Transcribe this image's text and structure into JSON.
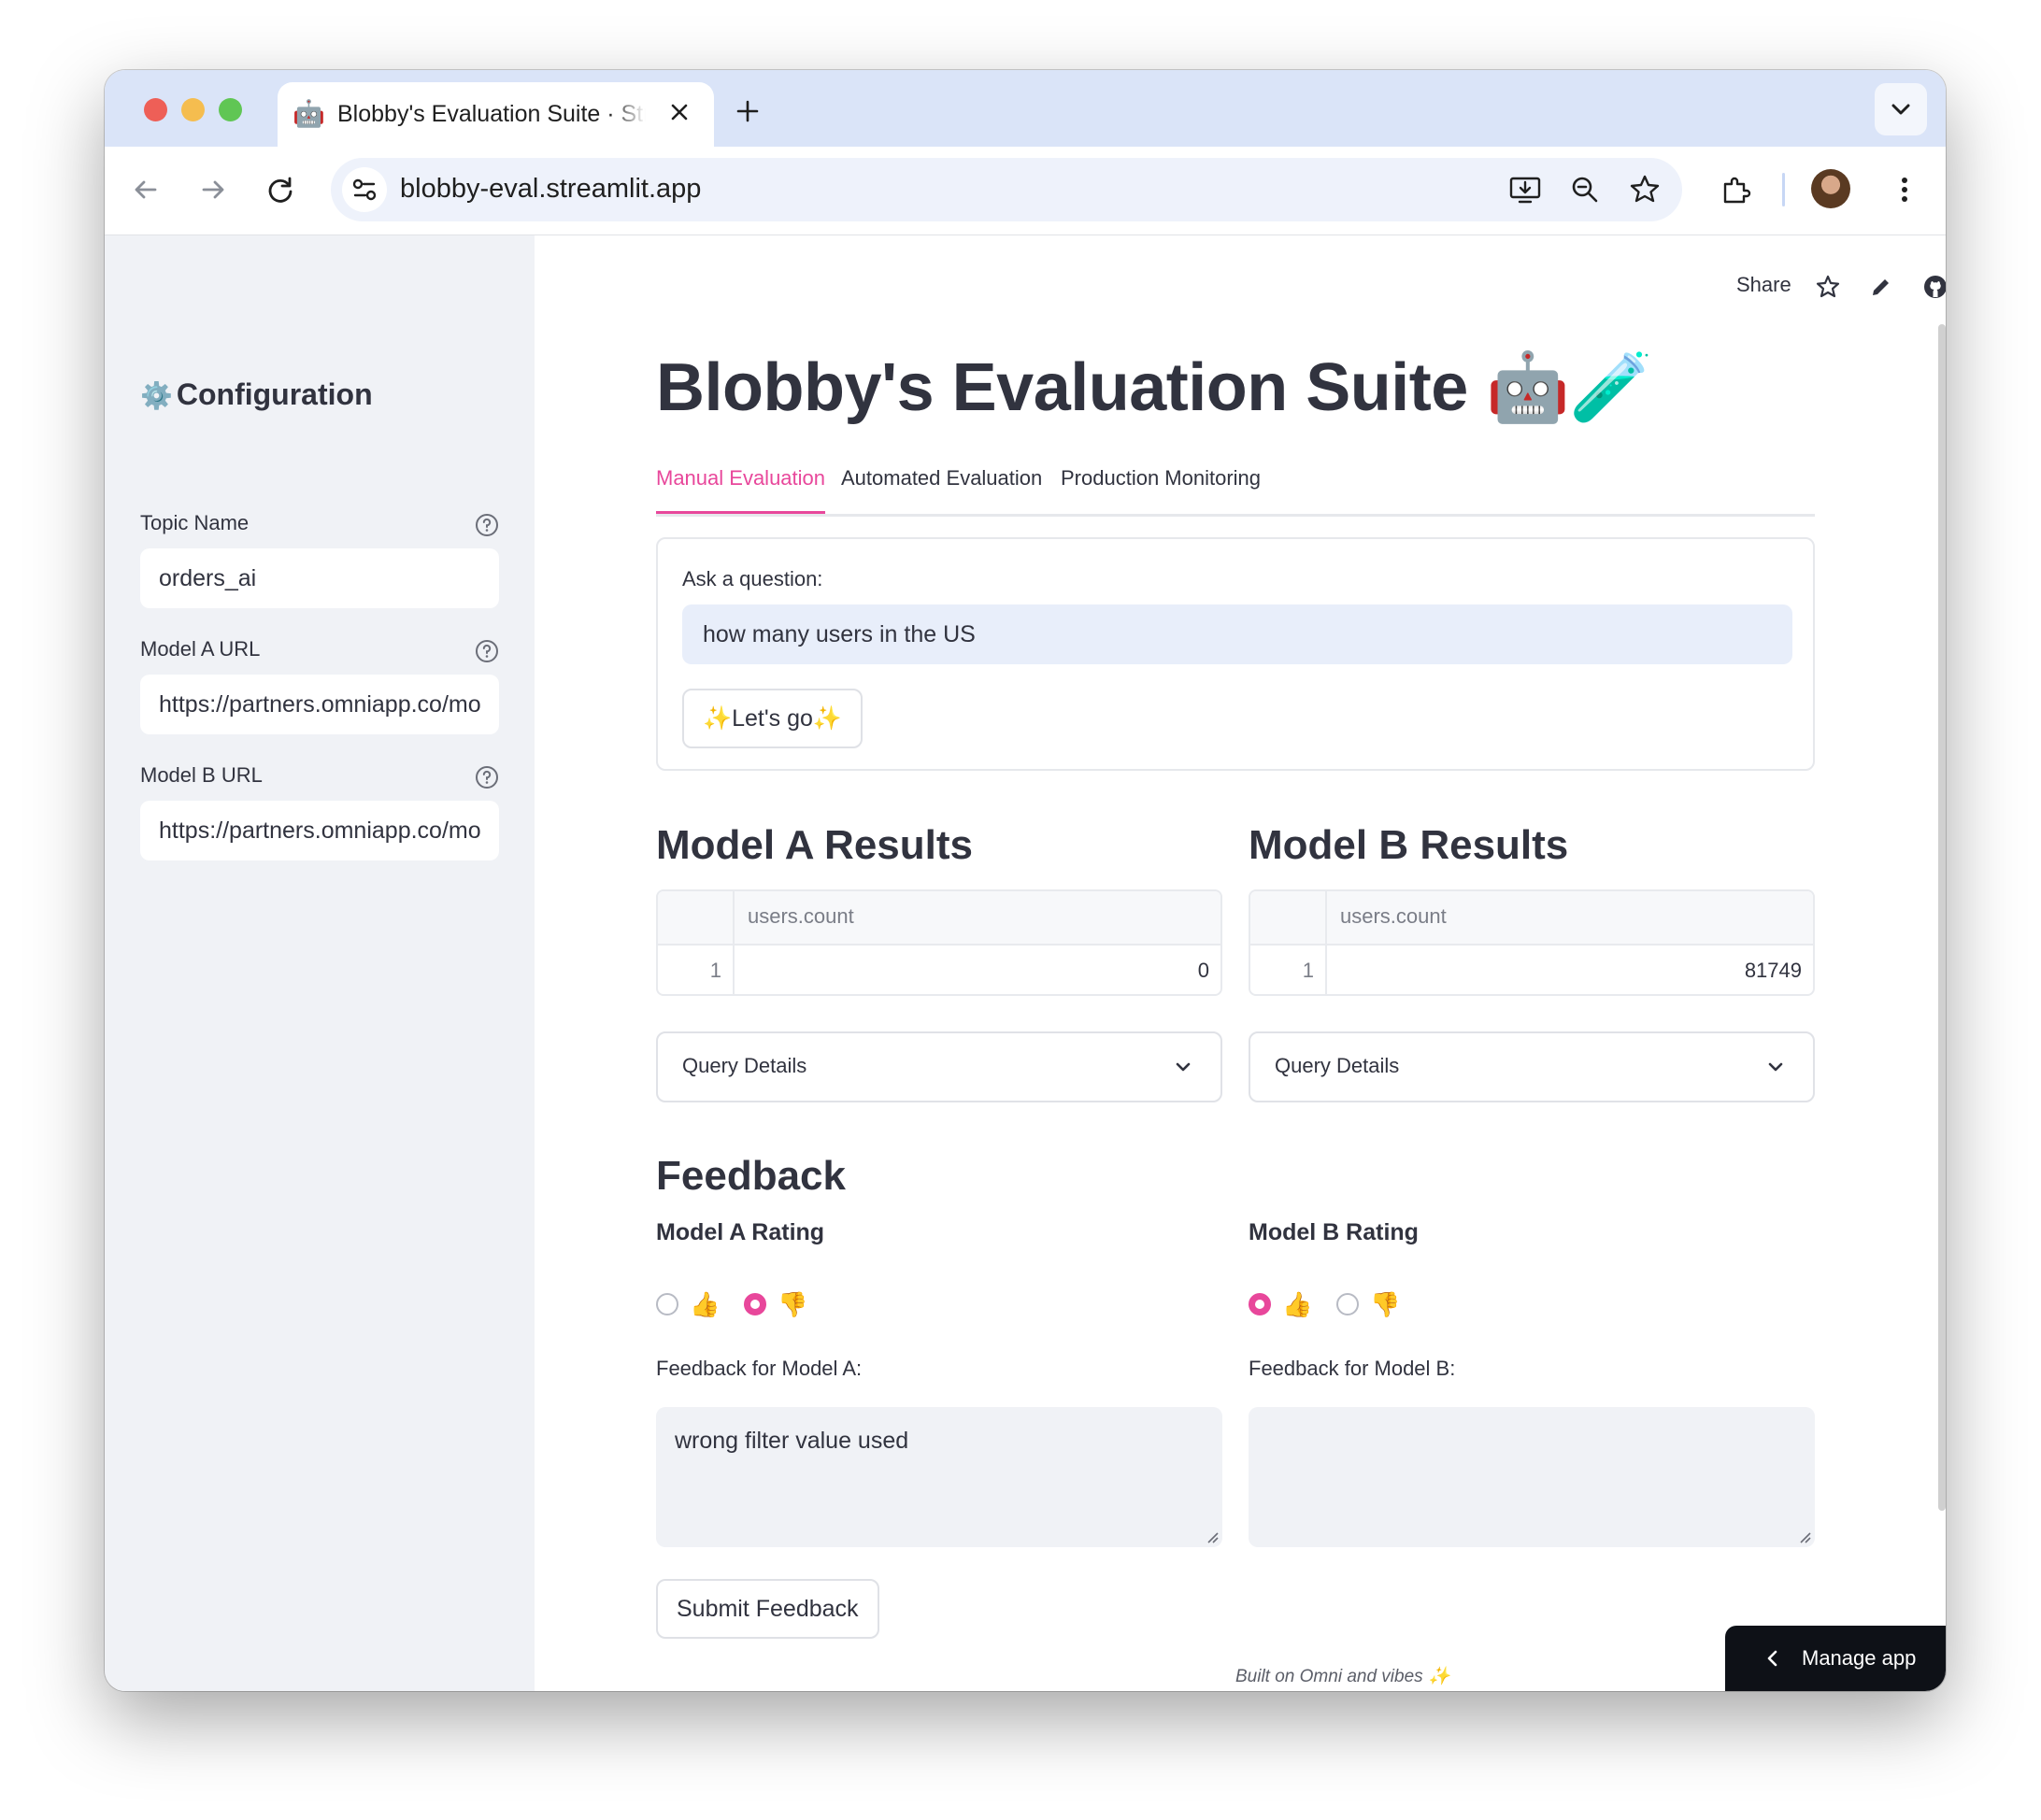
{
  "browser": {
    "tab_title": "Blobby's Evaluation Suite · Streamlit",
    "tab_favicon": "🤖",
    "url": "blobby-eval.streamlit.app"
  },
  "sidebar": {
    "title_icon": "⚙️",
    "title": "Configuration",
    "fields": [
      {
        "label": "Topic Name",
        "value": "orders_ai"
      },
      {
        "label": "Model A URL",
        "value": "https://partners.omniapp.co/mo"
      },
      {
        "label": "Model B URL",
        "value": "https://partners.omniapp.co/mo"
      }
    ]
  },
  "header": {
    "share_label": "Share"
  },
  "main": {
    "title": "Blobby's Evaluation Suite 🤖🧪",
    "tabs": [
      {
        "label": "Manual Evaluation",
        "active": true
      },
      {
        "label": "Automated Evaluation",
        "active": false
      },
      {
        "label": "Production Monitoring",
        "active": false
      }
    ],
    "question": {
      "label": "Ask a question:",
      "value": "how many users in the US",
      "button": "✨Let's go✨"
    },
    "results": [
      {
        "title": "Model A Results",
        "column": "users.count",
        "row_index": "1",
        "value": "0",
        "expander": "Query Details"
      },
      {
        "title": "Model B Results",
        "column": "users.count",
        "row_index": "1",
        "value": "81749",
        "expander": "Query Details"
      }
    ],
    "feedback": {
      "title": "Feedback",
      "models": [
        {
          "rating_label": "Model A Rating",
          "options": [
            "👍",
            "👎"
          ],
          "selected": "👎",
          "feedback_label": "Feedback for Model A:",
          "feedback_value": "wrong filter value used"
        },
        {
          "rating_label": "Model B Rating",
          "options": [
            "👍",
            "👎"
          ],
          "selected": "👍",
          "feedback_label": "Feedback for Model B:",
          "feedback_value": ""
        }
      ],
      "submit_label": "Submit Feedback"
    },
    "footer": "Built on Omni and vibes ✨"
  },
  "manage_app": {
    "label": "Manage app"
  },
  "colors": {
    "accent": "#e8479b",
    "sidebar_bg": "#f0f2f6",
    "tabstrip_bg": "#dae4f8",
    "text": "#31333f"
  }
}
